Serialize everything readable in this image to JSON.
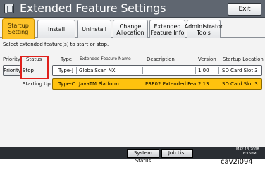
{
  "window": {
    "title": "Extended Feature Settings",
    "exit_label": "Exit"
  },
  "tabs": [
    {
      "line1": "Startup",
      "line2": "Setting"
    },
    {
      "line1": "Install",
      "line2": ""
    },
    {
      "line1": "Uninstall",
      "line2": ""
    },
    {
      "line1": "Change",
      "line2": "Allocation"
    },
    {
      "line1": "Extended",
      "line2": "Feature Info"
    },
    {
      "line1": "Administrator",
      "line2": "Tools"
    }
  ],
  "instruction": "Select extended feature(s) to start or stop.",
  "columns": {
    "priority": "Priority",
    "status": "Status",
    "type": "Type",
    "name": "Extended Feature Name",
    "description": "Description",
    "version": "Version",
    "location": "Startup Location"
  },
  "rows": [
    {
      "priority": "Priority",
      "status": "Stop",
      "type": "Type-J",
      "name": "GlobalScan NX",
      "description": "",
      "version": "1.00",
      "location": "SD Card Slot 3"
    },
    {
      "priority": "",
      "status": "Starting Up",
      "type": "Type-C",
      "name": "JavaTM Platform",
      "description": "PRE02 Extended Feat...",
      "version": "2.13",
      "location": "SD Card Slot 3"
    }
  ],
  "statusbar": {
    "system_status": "System Status",
    "job_list": "Job List",
    "date": "MAY  13,2008",
    "time": "6:16PM"
  },
  "caption": "cav2i094",
  "colors": {
    "titlebar": "#5f6670",
    "active_tab": "#ffc42a",
    "selected_row": "#ffc20e",
    "highlight": "#e0201b",
    "statusbar": "#2a2e33"
  }
}
